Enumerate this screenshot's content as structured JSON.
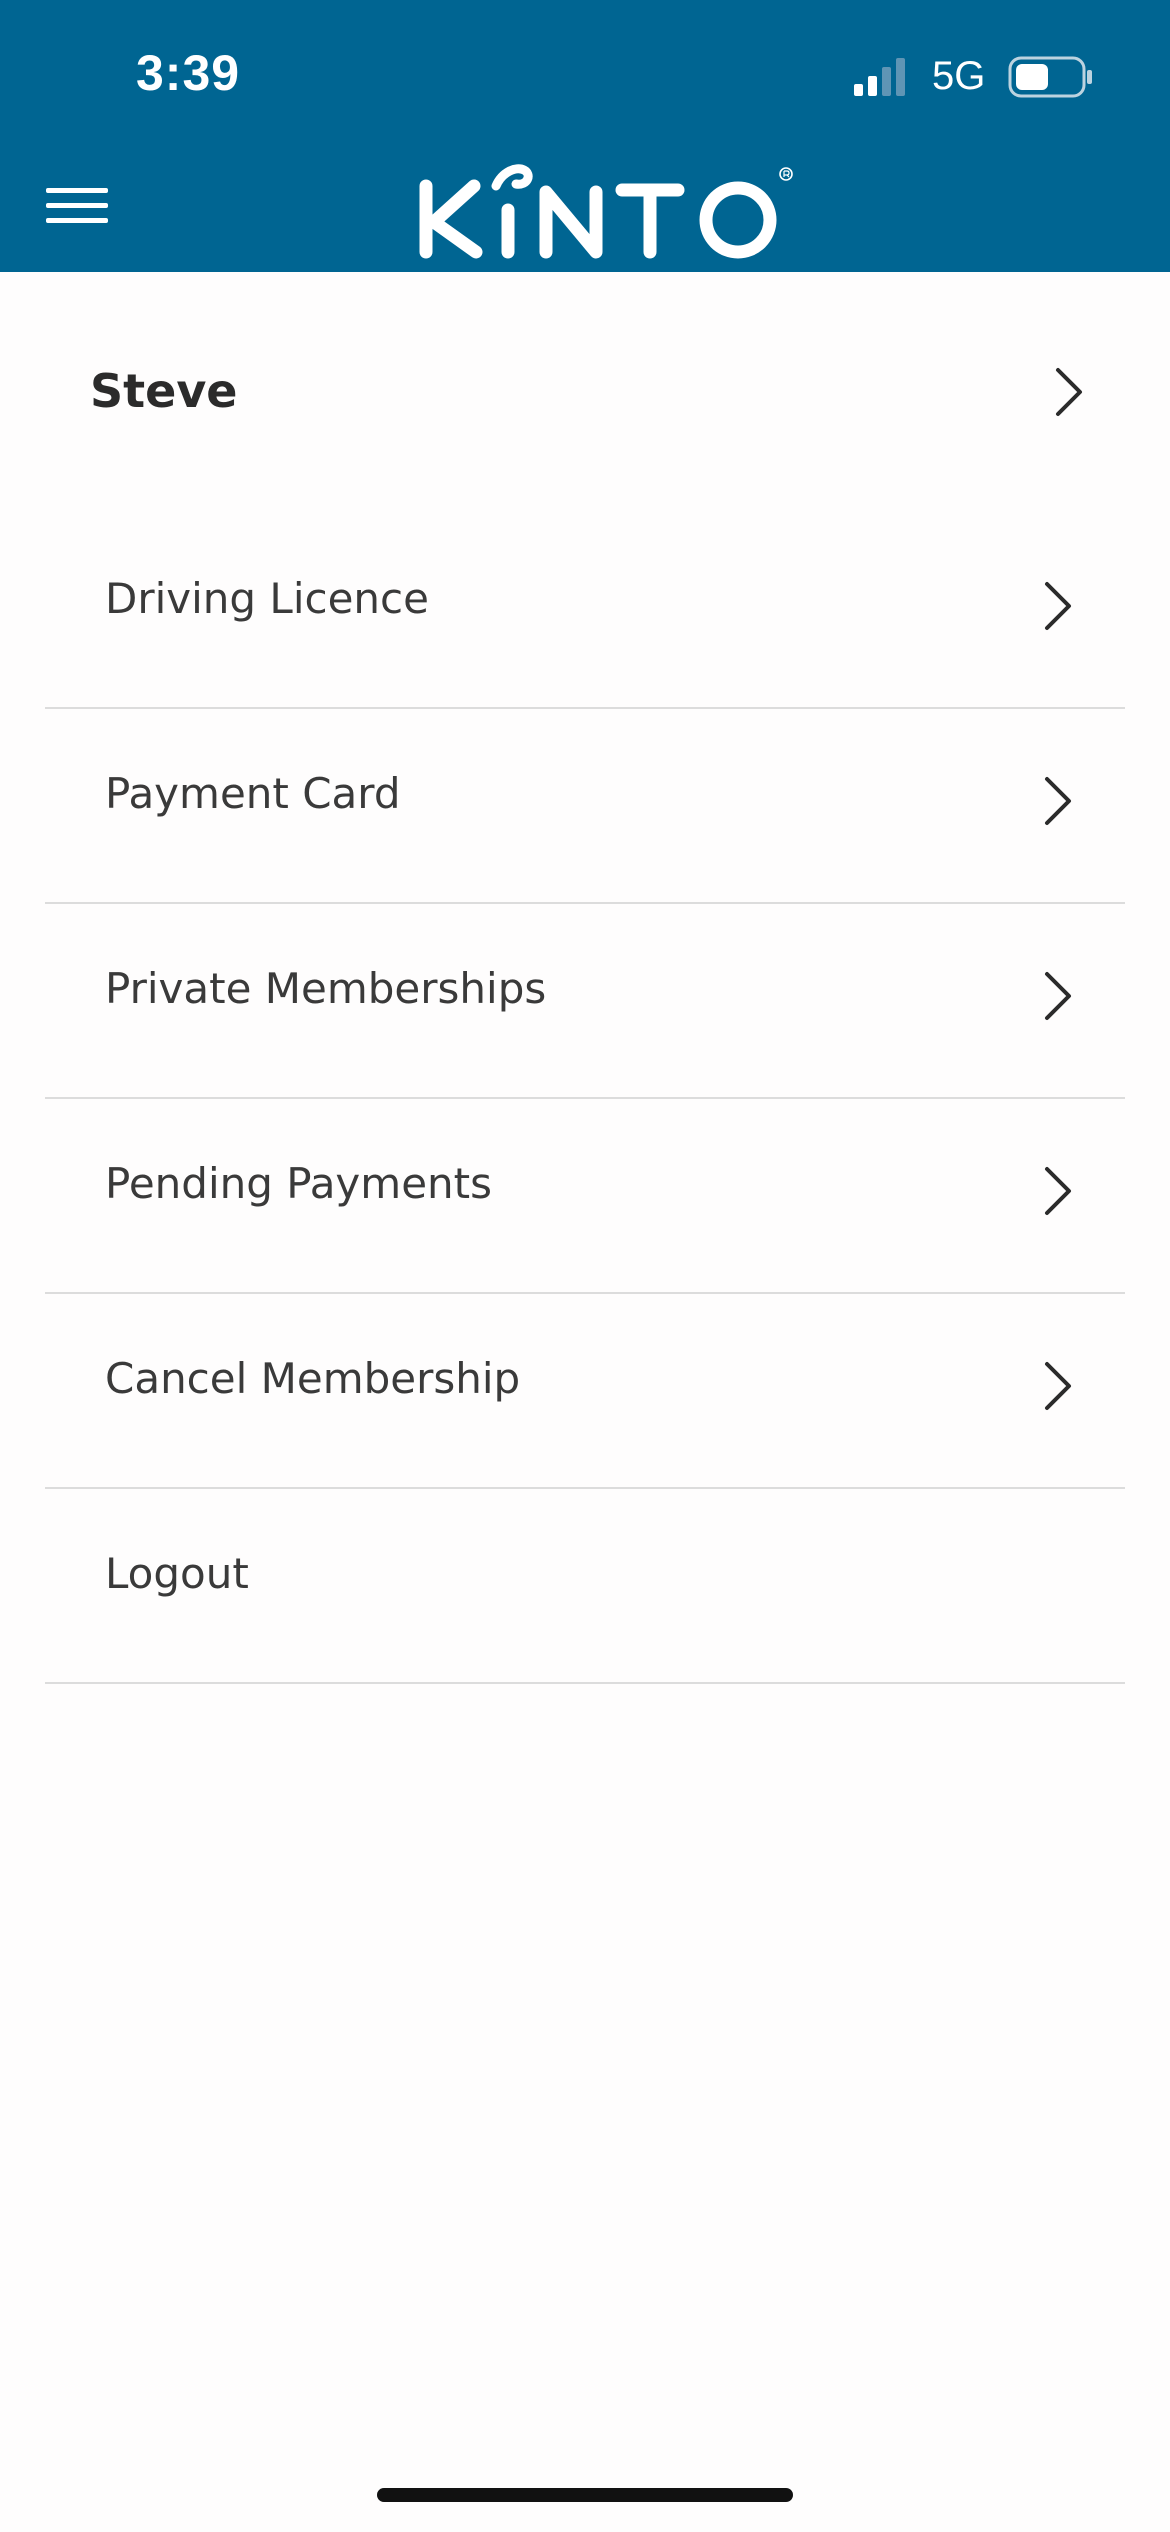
{
  "status_bar": {
    "time": "3:39",
    "network": "5G"
  },
  "header": {
    "brand": "KINTO",
    "menu_icon": "hamburger-menu-icon"
  },
  "colors": {
    "header_bg": "#006592",
    "text": "#3a3a3a",
    "divider": "#dcdcdc"
  },
  "profile": {
    "name": "Steve"
  },
  "menu_items": [
    {
      "label": "Driving Licence",
      "has_chevron": true
    },
    {
      "label": "Payment Card",
      "has_chevron": true
    },
    {
      "label": "Private Memberships",
      "has_chevron": true
    },
    {
      "label": "Pending Payments",
      "has_chevron": true
    },
    {
      "label": "Cancel Membership",
      "has_chevron": true
    },
    {
      "label": "Logout",
      "has_chevron": false
    }
  ]
}
